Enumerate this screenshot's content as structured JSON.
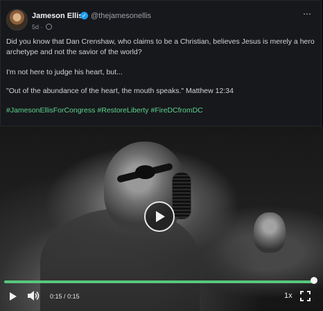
{
  "post": {
    "author_name": "Jameson Ellis",
    "handle": "@thejamesonellis",
    "timestamp": "5d",
    "separator": "·",
    "paragraphs": [
      "Did you know that Dan Crenshaw, who claims to be a Christian, believes Jesus is merely a hero archetype and not the savior of the world?",
      "I'm not here to judge his heart, but...",
      "\"Out of the abundance of the heart, the mouth speaks.\" Matthew 12:34"
    ],
    "hashtags": [
      "#JamesonEllisForCongress",
      "#RestoreLiberty",
      "#FireDCfromDC"
    ],
    "more_icon": "⋯",
    "verified_icon": "✓"
  },
  "video": {
    "current_time": "0:15",
    "time_separator": "/",
    "duration": "0:15",
    "playback_speed": "1x",
    "progress_fraction": 1.0
  },
  "icons": {
    "play": "play-icon",
    "volume": "volume-icon",
    "fullscreen": "fullscreen-icon"
  },
  "colors": {
    "accent_green": "#57c77d",
    "hashtag_green": "#5bd48c",
    "verified_blue": "#1d9bf0"
  }
}
